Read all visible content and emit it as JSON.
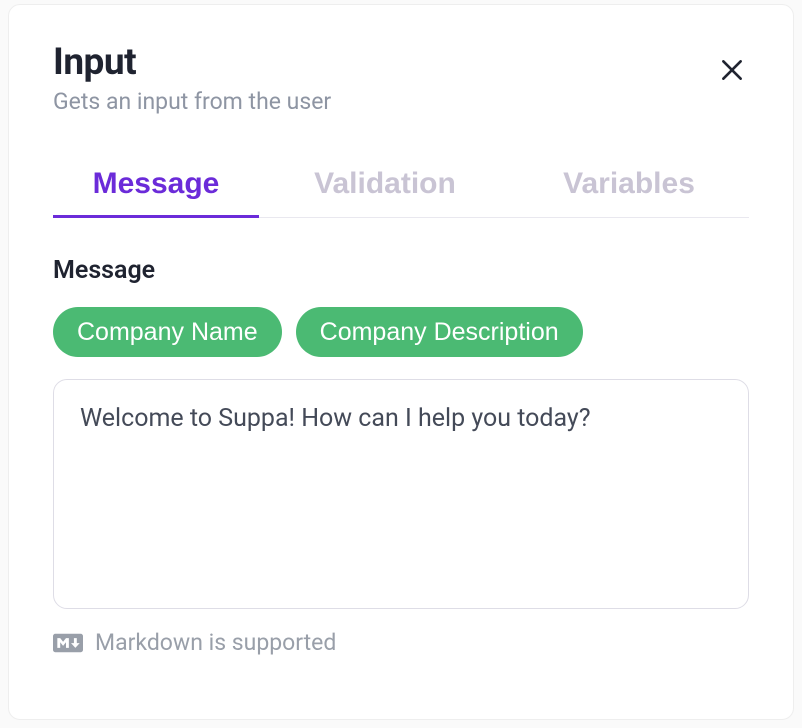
{
  "header": {
    "title": "Input",
    "subtitle": "Gets an input from the user"
  },
  "tabs": [
    {
      "label": "Message",
      "active": true
    },
    {
      "label": "Validation",
      "active": false
    },
    {
      "label": "Variables",
      "active": false
    }
  ],
  "message": {
    "label": "Message",
    "chips": [
      "Company Name",
      "Company Description"
    ],
    "value": "Welcome to Suppa! How can I help you today?"
  },
  "markdown_hint": "Markdown is supported"
}
